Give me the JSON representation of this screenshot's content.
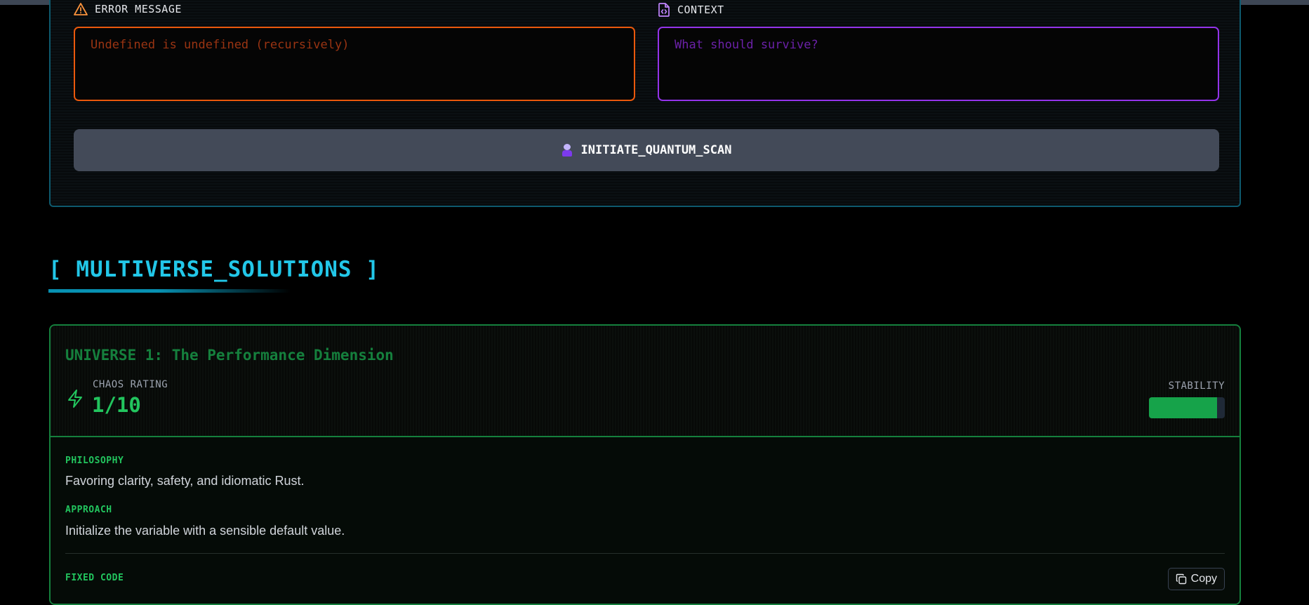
{
  "colors": {
    "accent_cyan": "#22c7e8",
    "error_orange": "#ea580c",
    "context_purple": "#9333ea",
    "universe_green": "#22c55e"
  },
  "input_panel": {
    "error_label": "ERROR MESSAGE",
    "error_icon": "warning-triangle-icon",
    "error_placeholder": "Undefined is undefined (recursively)",
    "context_label": "CONTEXT",
    "context_icon": "code-file-icon",
    "context_placeholder": "What should survive?",
    "scan_button_label": "INITIATE_QUANTUM_SCAN",
    "scan_button_icon": "scientist-emoji-icon"
  },
  "solutions": {
    "section_title": "[ MULTIVERSE_SOLUTIONS ]",
    "universes": [
      {
        "title": "UNIVERSE 1: The Performance Dimension",
        "chaos_label": "CHAOS RATING",
        "chaos_value": "1/10",
        "chaos_icon": "lightning-bolt-icon",
        "stability_label": "STABILITY",
        "stability_fraction": 0.9,
        "philosophy_label": "PHILOSOPHY",
        "philosophy_text": "Favoring clarity, safety, and idiomatic Rust.",
        "approach_label": "APPROACH",
        "approach_text": "Initialize the variable with a sensible default value.",
        "fixed_code_label": "FIXED CODE",
        "copy_label": "Copy",
        "copy_icon": "copy-icon"
      }
    ]
  }
}
